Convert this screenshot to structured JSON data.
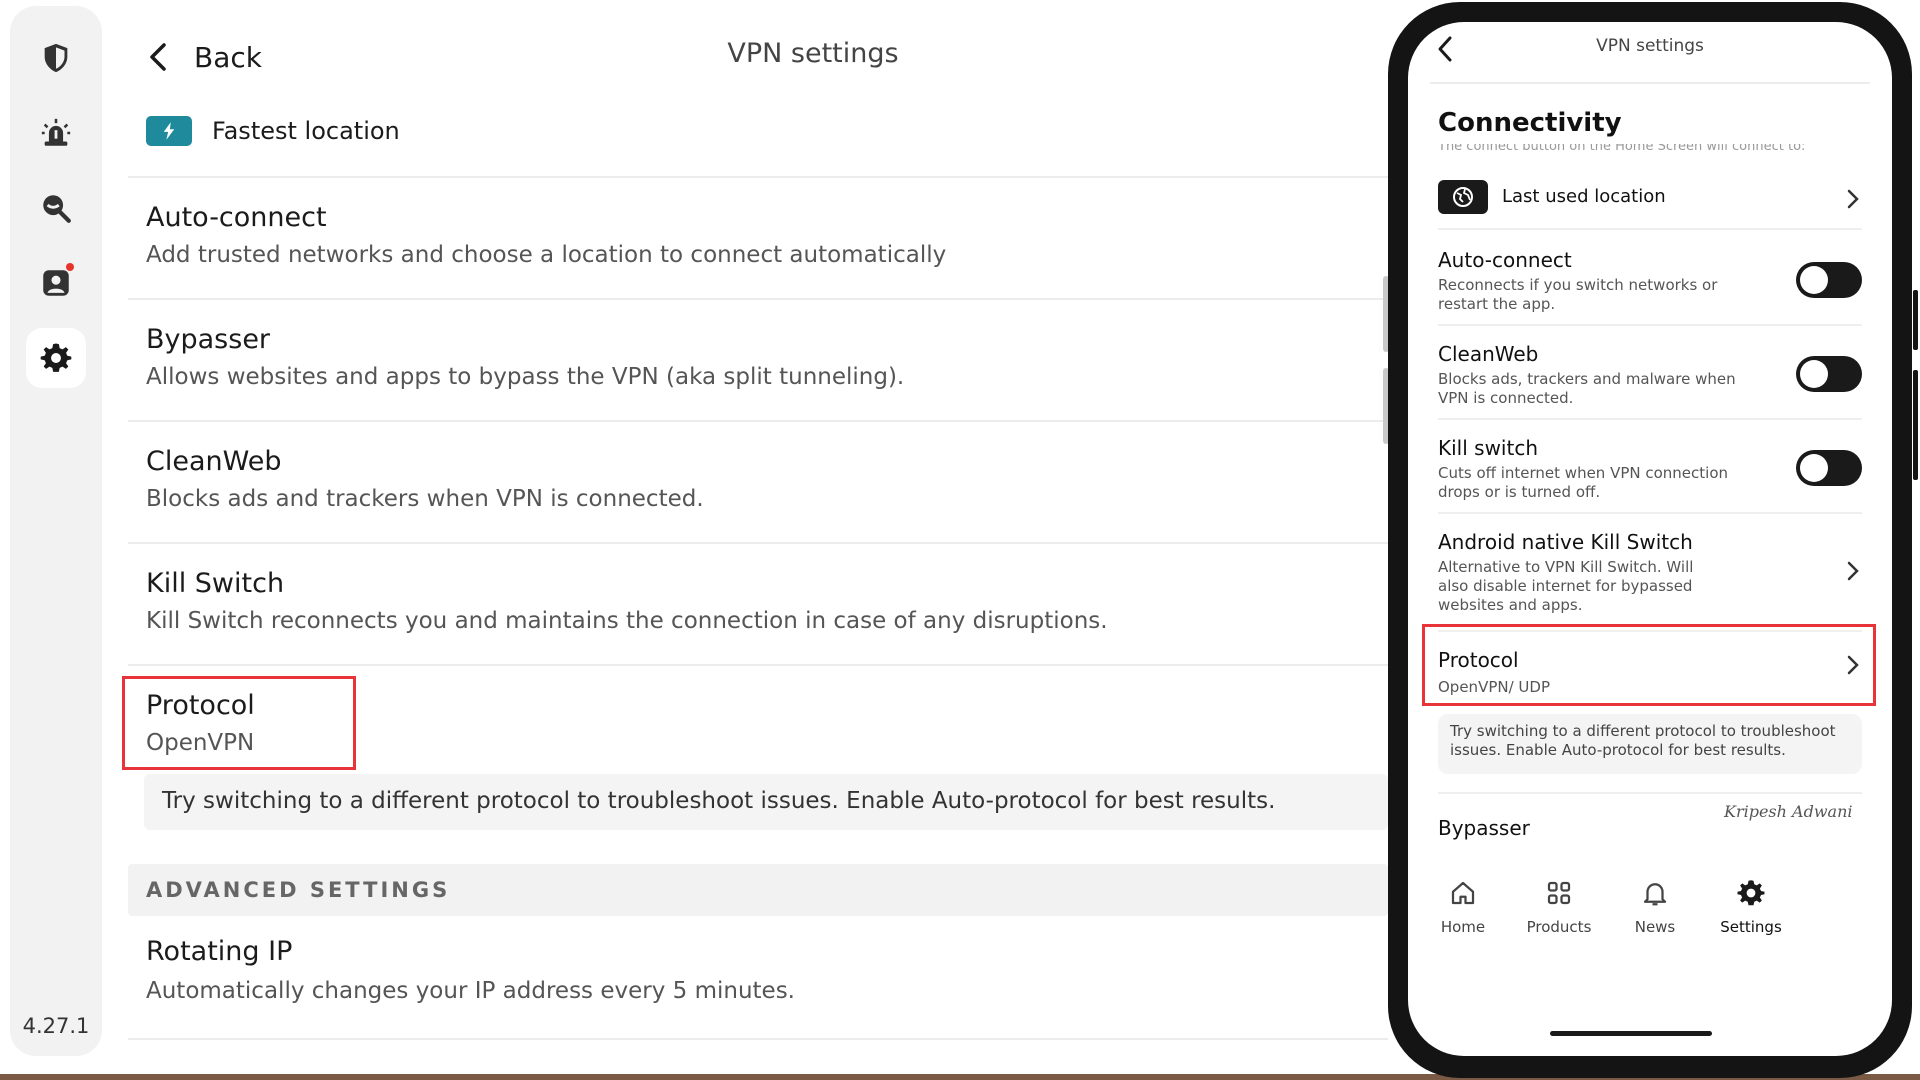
{
  "app": {
    "version": "4.27.1",
    "nav": [
      {
        "icon": "shield-icon",
        "active": false
      },
      {
        "icon": "alert-icon",
        "active": false
      },
      {
        "icon": "search-icon",
        "active": false
      },
      {
        "icon": "account-icon",
        "active": false,
        "badge": true
      },
      {
        "icon": "gear-icon",
        "active": true
      }
    ]
  },
  "desktop": {
    "back_label": "Back",
    "title": "VPN settings",
    "fastest_label": "Fastest location",
    "items": [
      {
        "title": "Auto-connect",
        "subtitle": "Add trusted networks and choose a location to connect automatically"
      },
      {
        "title": "Bypasser",
        "subtitle": "Allows websites and apps to bypass the VPN (aka split tunneling)."
      },
      {
        "title": "CleanWeb",
        "subtitle": "Blocks ads and trackers when VPN is connected."
      },
      {
        "title": "Kill Switch",
        "subtitle": "Kill Switch reconnects you and maintains the connection in case of any disruptions."
      },
      {
        "title": "Protocol",
        "subtitle": "OpenVPN"
      }
    ],
    "protocol_tip": "Try switching to a different protocol to troubleshoot issues. Enable Auto-protocol for best results.",
    "advanced_header": "ADVANCED SETTINGS",
    "advanced_items": [
      {
        "title": "Rotating IP",
        "subtitle": "Automatically changes your IP address every 5 minutes."
      }
    ]
  },
  "mobile": {
    "title": "VPN settings",
    "section": "Connectivity",
    "section_hidden_text": "The connect button on the Home Screen will connect to:",
    "location_label": "Last used location",
    "rows": [
      {
        "title": "Auto-connect",
        "subtitle": "Reconnects if you switch networks or restart the app.",
        "toggle": false
      },
      {
        "title": "CleanWeb",
        "subtitle": "Blocks ads, trackers and malware when VPN is connected.",
        "toggle": false
      },
      {
        "title": "Kill switch",
        "subtitle": "Cuts off internet when VPN connection drops or is turned off.",
        "toggle": false
      },
      {
        "title": "Android native Kill Switch",
        "subtitle": "Alternative to VPN Kill Switch. Will also disable internet for bypassed websites and apps."
      },
      {
        "title": "Protocol",
        "subtitle": "OpenVPN/ UDP"
      }
    ],
    "protocol_tip": "Try switching to a different protocol to troubleshoot issues. Enable Auto-protocol for best results.",
    "bypasser_label": "Bypasser",
    "signature": "Kripesh Adwani",
    "tabs": [
      {
        "label": "Home",
        "icon": "home-icon"
      },
      {
        "label": "Products",
        "icon": "grid-icon"
      },
      {
        "label": "News",
        "icon": "bell-icon"
      },
      {
        "label": "Settings",
        "icon": "gear-icon",
        "active": true
      }
    ]
  }
}
